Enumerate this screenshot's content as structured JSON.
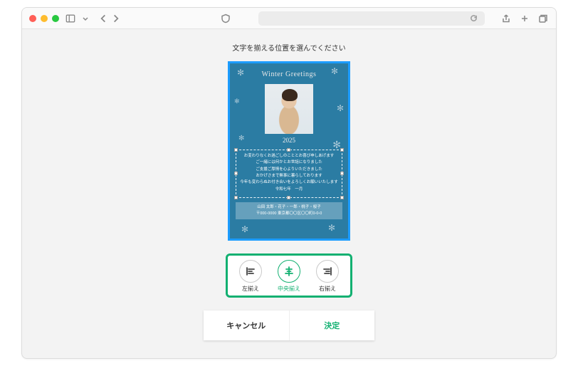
{
  "instruction": "文字を揃える位置を選んでください",
  "card": {
    "title": "Winter Greetings",
    "year": "2025",
    "text_lines": [
      "お変わりなくお過ごしのこととお喜び申しあげます",
      "ご一緒には何かとお世話になりました",
      "ご支援ご厚情を心よりいただきました",
      "おかげさまで無事に暮らしております",
      "今年も変わらぬお付き合いをよろしくお願いいたします",
      "令和七年　一月"
    ],
    "names": "山田 太郎・花子・一郎・桃子・桜子",
    "address": "〒000-0000 東京都〇〇区〇〇町0-0-0"
  },
  "align": {
    "options": [
      {
        "id": "left",
        "label": "左揃え"
      },
      {
        "id": "center",
        "label": "中央揃え"
      },
      {
        "id": "right",
        "label": "右揃え"
      }
    ],
    "selected": "center"
  },
  "footer": {
    "cancel": "キャンセル",
    "confirm": "決定"
  }
}
